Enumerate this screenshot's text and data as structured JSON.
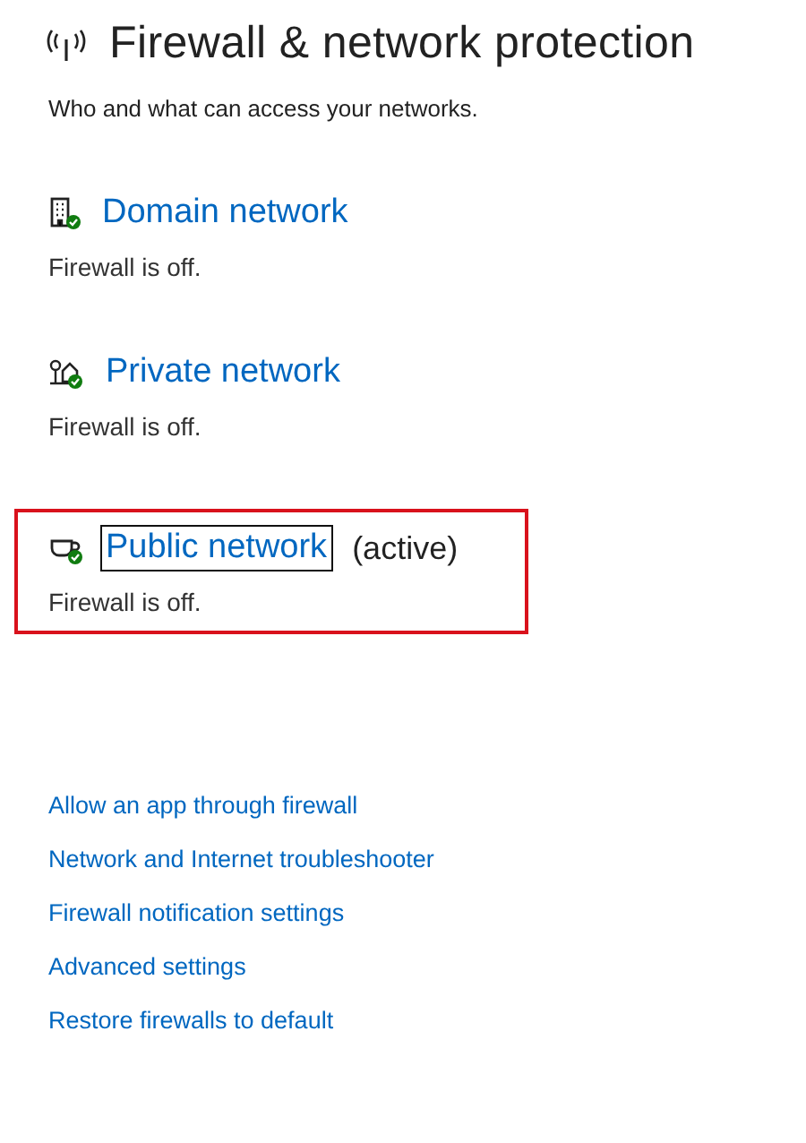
{
  "header": {
    "title": "Firewall & network protection",
    "subtitle": "Who and what can access your networks."
  },
  "networks": [
    {
      "kind": "domain",
      "name": "Domain network",
      "status": "Firewall is off.",
      "focused": false,
      "highlighted": false
    },
    {
      "kind": "private",
      "name": "Private network",
      "status": "Firewall is off.",
      "focused": false,
      "highlighted": false
    },
    {
      "kind": "public",
      "name": "Public network",
      "note": "(active)",
      "status": "Firewall is off.",
      "focused": true,
      "highlighted": true
    }
  ],
  "links": [
    "Allow an app through firewall",
    "Network and Internet troubleshooter",
    "Firewall notification settings",
    "Advanced settings",
    "Restore firewalls to default"
  ]
}
